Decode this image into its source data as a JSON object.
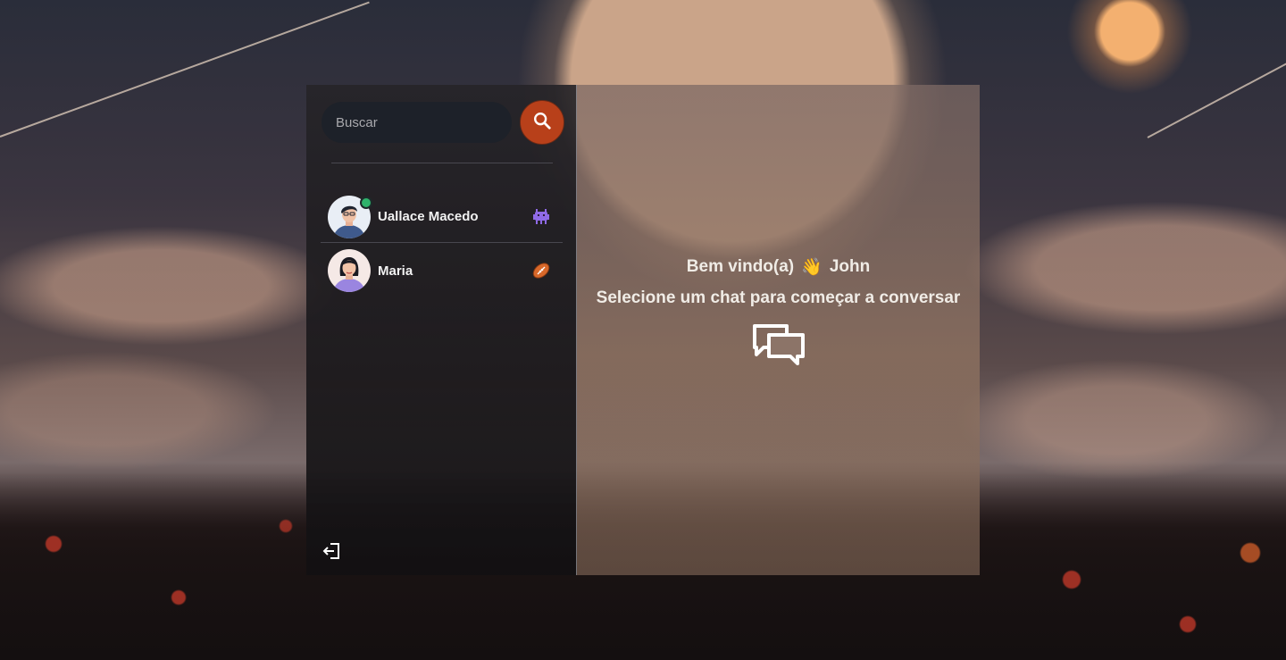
{
  "search": {
    "placeholder": "Buscar"
  },
  "conversations": [
    {
      "name": "Uallace Macedo",
      "emoji_icon": "alien-monster-icon",
      "online": true
    },
    {
      "name": "Maria",
      "emoji_icon": "football-icon",
      "online": false
    }
  ],
  "welcome": {
    "greeting": "Bem vindo(a)",
    "wave_emoji": "👋",
    "user_name": "John",
    "subtitle": "Selecione um chat para começar a conversar"
  },
  "colors": {
    "accent": "#b8401a",
    "online": "#2fb36b",
    "input_bg": "#1d2129"
  }
}
